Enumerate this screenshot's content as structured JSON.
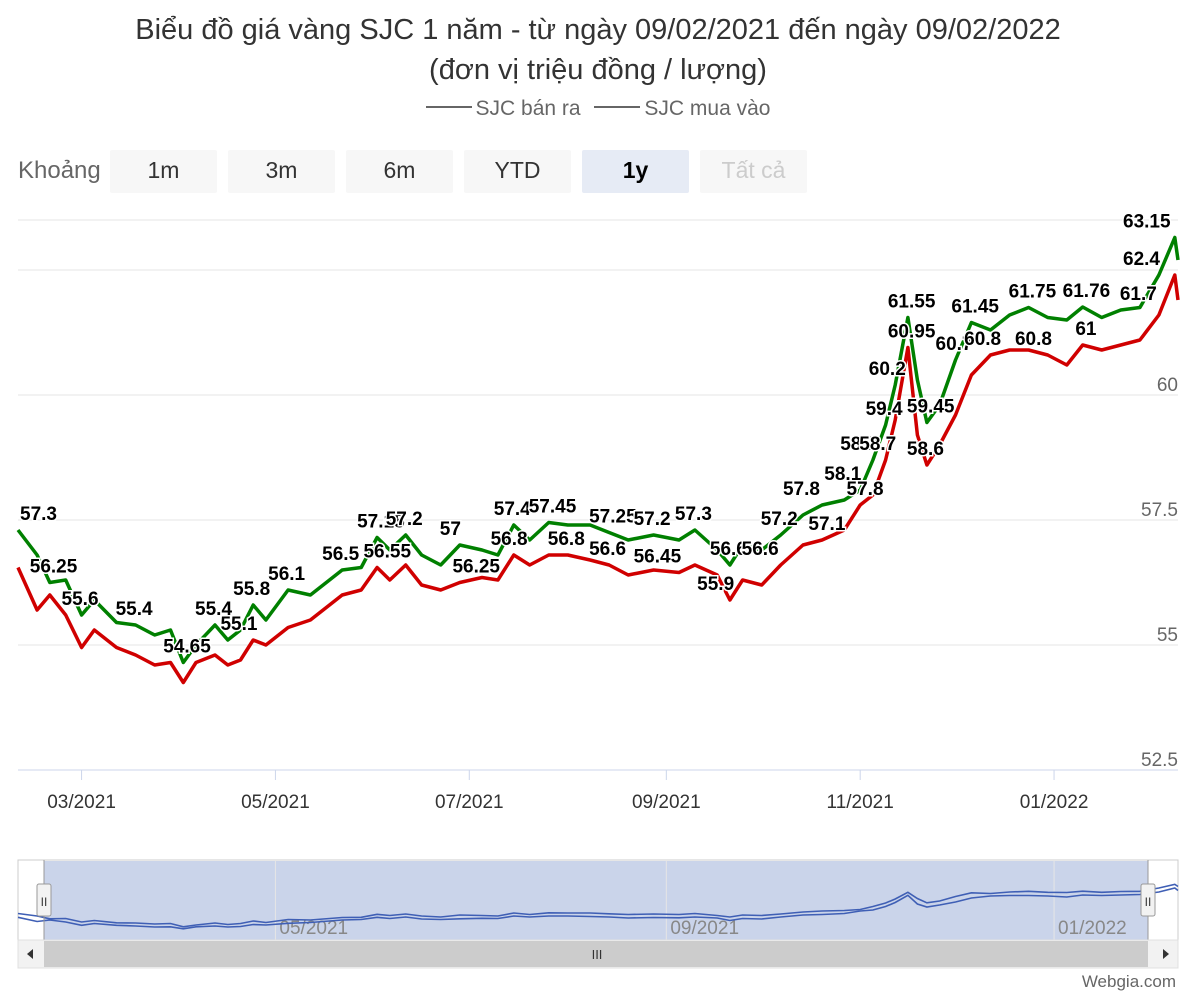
{
  "chart_data": {
    "type": "line",
    "title": "Biểu đồ giá vàng SJC 1 năm - từ ngày 09/02/2021 đến ngày 09/02/2022",
    "subtitle": "(đơn vị triệu đồng / lượng)",
    "ylim": [
      52.5,
      63.5
    ],
    "yticks": [
      "52.5",
      "55",
      "57.5",
      "60"
    ],
    "xticks": [
      "03/2021",
      "05/2021",
      "07/2021",
      "09/2021",
      "11/2021",
      "01/2022"
    ],
    "navigator_ticks": [
      "05/2021",
      "09/2021",
      "01/2022"
    ],
    "xrange": [
      "2021-02-09",
      "2022-02-09"
    ],
    "grid": true,
    "legend_position": "top-center",
    "series": [
      {
        "name": "SJC bán ra",
        "color": "#008000",
        "points": [
          [
            "2021-02-09",
            57.3
          ],
          [
            "2021-02-15",
            56.8
          ],
          [
            "2021-02-19",
            56.25
          ],
          [
            "2021-02-24",
            56.3
          ],
          [
            "2021-03-01",
            55.6
          ],
          [
            "2021-03-05",
            55.9
          ],
          [
            "2021-03-12",
            55.45
          ],
          [
            "2021-03-18",
            55.4
          ],
          [
            "2021-03-24",
            55.2
          ],
          [
            "2021-03-29",
            55.3
          ],
          [
            "2021-04-02",
            54.65
          ],
          [
            "2021-04-06",
            55.0
          ],
          [
            "2021-04-12",
            55.4
          ],
          [
            "2021-04-16",
            55.1
          ],
          [
            "2021-04-20",
            55.3
          ],
          [
            "2021-04-24",
            55.8
          ],
          [
            "2021-04-28",
            55.5
          ],
          [
            "2021-05-05",
            56.1
          ],
          [
            "2021-05-12",
            56.0
          ],
          [
            "2021-05-18",
            56.3
          ],
          [
            "2021-05-22",
            56.5
          ],
          [
            "2021-05-28",
            56.55
          ],
          [
            "2021-06-02",
            57.15
          ],
          [
            "2021-06-06",
            56.9
          ],
          [
            "2021-06-11",
            57.2
          ],
          [
            "2021-06-16",
            56.8
          ],
          [
            "2021-06-22",
            56.6
          ],
          [
            "2021-06-28",
            57.0
          ],
          [
            "2021-07-05",
            56.9
          ],
          [
            "2021-07-10",
            56.8
          ],
          [
            "2021-07-15",
            57.4
          ],
          [
            "2021-07-20",
            57.1
          ],
          [
            "2021-07-26",
            57.45
          ],
          [
            "2021-08-01",
            57.4
          ],
          [
            "2021-08-08",
            57.4
          ],
          [
            "2021-08-14",
            57.25
          ],
          [
            "2021-08-20",
            57.1
          ],
          [
            "2021-08-28",
            57.2
          ],
          [
            "2021-09-05",
            57.1
          ],
          [
            "2021-09-10",
            57.3
          ],
          [
            "2021-09-17",
            56.9
          ],
          [
            "2021-09-21",
            56.6
          ],
          [
            "2021-09-25",
            57.0
          ],
          [
            "2021-10-01",
            56.9
          ],
          [
            "2021-10-07",
            57.2
          ],
          [
            "2021-10-14",
            57.6
          ],
          [
            "2021-10-20",
            57.8
          ],
          [
            "2021-10-27",
            57.9
          ],
          [
            "2021-11-01",
            58.1
          ],
          [
            "2021-11-05",
            58.7
          ],
          [
            "2021-11-09",
            59.4
          ],
          [
            "2021-11-12",
            60.2
          ],
          [
            "2021-11-16",
            61.55
          ],
          [
            "2021-11-19",
            60.3
          ],
          [
            "2021-11-22",
            59.45
          ],
          [
            "2021-11-26",
            59.8
          ],
          [
            "2021-12-01",
            60.7
          ],
          [
            "2021-12-06",
            61.45
          ],
          [
            "2021-12-12",
            61.3
          ],
          [
            "2021-12-18",
            61.6
          ],
          [
            "2021-12-24",
            61.75
          ],
          [
            "2021-12-30",
            61.55
          ],
          [
            "2022-01-05",
            61.5
          ],
          [
            "2022-01-10",
            61.76
          ],
          [
            "2022-01-16",
            61.55
          ],
          [
            "2022-01-22",
            61.7
          ],
          [
            "2022-01-28",
            61.75
          ],
          [
            "2022-02-03",
            62.4
          ],
          [
            "2022-02-08",
            63.15
          ],
          [
            "2022-02-09",
            62.7
          ]
        ]
      },
      {
        "name": "SJC mua vào",
        "color": "#d00000",
        "points": [
          [
            "2021-02-09",
            56.55
          ],
          [
            "2021-02-15",
            55.7
          ],
          [
            "2021-02-19",
            56.0
          ],
          [
            "2021-02-24",
            55.6
          ],
          [
            "2021-03-01",
            54.95
          ],
          [
            "2021-03-05",
            55.3
          ],
          [
            "2021-03-12",
            54.95
          ],
          [
            "2021-03-18",
            54.8
          ],
          [
            "2021-03-24",
            54.6
          ],
          [
            "2021-03-29",
            54.65
          ],
          [
            "2021-04-02",
            54.25
          ],
          [
            "2021-04-06",
            54.65
          ],
          [
            "2021-04-12",
            54.8
          ],
          [
            "2021-04-16",
            54.6
          ],
          [
            "2021-04-20",
            54.7
          ],
          [
            "2021-04-24",
            55.1
          ],
          [
            "2021-04-28",
            55.0
          ],
          [
            "2021-05-05",
            55.35
          ],
          [
            "2021-05-12",
            55.5
          ],
          [
            "2021-05-18",
            55.8
          ],
          [
            "2021-05-22",
            56.0
          ],
          [
            "2021-05-28",
            56.1
          ],
          [
            "2021-06-02",
            56.55
          ],
          [
            "2021-06-06",
            56.3
          ],
          [
            "2021-06-11",
            56.6
          ],
          [
            "2021-06-16",
            56.2
          ],
          [
            "2021-06-22",
            56.1
          ],
          [
            "2021-06-28",
            56.25
          ],
          [
            "2021-07-05",
            56.35
          ],
          [
            "2021-07-10",
            56.3
          ],
          [
            "2021-07-15",
            56.8
          ],
          [
            "2021-07-20",
            56.6
          ],
          [
            "2021-07-26",
            56.8
          ],
          [
            "2021-08-01",
            56.8
          ],
          [
            "2021-08-08",
            56.7
          ],
          [
            "2021-08-14",
            56.6
          ],
          [
            "2021-08-20",
            56.4
          ],
          [
            "2021-08-28",
            56.5
          ],
          [
            "2021-09-05",
            56.45
          ],
          [
            "2021-09-10",
            56.6
          ],
          [
            "2021-09-17",
            56.4
          ],
          [
            "2021-09-21",
            55.9
          ],
          [
            "2021-09-25",
            56.3
          ],
          [
            "2021-10-01",
            56.2
          ],
          [
            "2021-10-07",
            56.6
          ],
          [
            "2021-10-14",
            57.0
          ],
          [
            "2021-10-20",
            57.1
          ],
          [
            "2021-10-27",
            57.3
          ],
          [
            "2021-11-01",
            57.8
          ],
          [
            "2021-11-05",
            58.0
          ],
          [
            "2021-11-09",
            58.7
          ],
          [
            "2021-11-12",
            59.5
          ],
          [
            "2021-11-16",
            60.95
          ],
          [
            "2021-11-19",
            59.2
          ],
          [
            "2021-11-22",
            58.6
          ],
          [
            "2021-11-26",
            59.0
          ],
          [
            "2021-12-01",
            59.6
          ],
          [
            "2021-12-06",
            60.4
          ],
          [
            "2021-12-12",
            60.8
          ],
          [
            "2021-12-18",
            60.9
          ],
          [
            "2021-12-24",
            60.9
          ],
          [
            "2021-12-30",
            60.8
          ],
          [
            "2022-01-05",
            60.6
          ],
          [
            "2022-01-10",
            61.0
          ],
          [
            "2022-01-16",
            60.9
          ],
          [
            "2022-01-22",
            61.0
          ],
          [
            "2022-01-28",
            61.1
          ],
          [
            "2022-02-03",
            61.6
          ],
          [
            "2022-02-08",
            62.4
          ],
          [
            "2022-02-09",
            61.9
          ]
        ]
      }
    ],
    "data_labels": [
      {
        "series": 0,
        "x": "2021-02-09",
        "text": "57.3"
      },
      {
        "series": 0,
        "x": "2021-02-19",
        "text": "56.25"
      },
      {
        "series": 0,
        "x": "2021-03-01",
        "text": "55.6"
      },
      {
        "series": 0,
        "x": "2021-03-18",
        "text": "55.4"
      },
      {
        "series": 0,
        "x": "2021-04-02",
        "text": "54.65"
      },
      {
        "series": 0,
        "x": "2021-04-12",
        "text": "55.4"
      },
      {
        "series": 0,
        "x": "2021-04-20",
        "text": "55.1"
      },
      {
        "series": 0,
        "x": "2021-04-24",
        "text": "55.8"
      },
      {
        "series": 0,
        "x": "2021-05-05",
        "text": "56.1"
      },
      {
        "series": 0,
        "x": "2021-05-22",
        "text": "56.5"
      },
      {
        "series": 0,
        "x": "2021-06-02",
        "text": "57.15"
      },
      {
        "series": 0,
        "x": "2021-06-04",
        "text": "56.55"
      },
      {
        "series": 0,
        "x": "2021-06-11",
        "text": "57.2"
      },
      {
        "series": 0,
        "x": "2021-06-28",
        "text": "57"
      },
      {
        "series": 0,
        "x": "2021-07-02",
        "text": "56.25"
      },
      {
        "series": 0,
        "x": "2021-07-15",
        "text": "57.4"
      },
      {
        "series": 0,
        "x": "2021-07-14",
        "text": "56.8"
      },
      {
        "series": 0,
        "x": "2021-07-26",
        "text": "57.45"
      },
      {
        "series": 0,
        "x": "2021-08-01",
        "text": "56.8"
      },
      {
        "series": 0,
        "x": "2021-08-14",
        "text": "57.25"
      },
      {
        "series": 0,
        "x": "2021-08-14",
        "text": "56.6"
      },
      {
        "series": 0,
        "x": "2021-08-28",
        "text": "57.2"
      },
      {
        "series": 0,
        "x": "2021-08-28",
        "text": "56.45"
      },
      {
        "series": 0,
        "x": "2021-09-10",
        "text": "57.3"
      },
      {
        "series": 0,
        "x": "2021-09-21",
        "text": "56.6"
      },
      {
        "series": 0,
        "x": "2021-09-17",
        "text": "55.9"
      },
      {
        "series": 0,
        "x": "2021-10-01",
        "text": "56.6"
      },
      {
        "series": 0,
        "x": "2021-10-07",
        "text": "57.2"
      },
      {
        "series": 0,
        "x": "2021-10-14",
        "text": "57.8"
      },
      {
        "series": 0,
        "x": "2021-10-22",
        "text": "57.1"
      },
      {
        "series": 0,
        "x": "2021-10-27",
        "text": "58.1"
      },
      {
        "series": 0,
        "x": "2021-11-01",
        "text": "58.7"
      },
      {
        "series": 0,
        "x": "2021-11-03",
        "text": "57.8"
      },
      {
        "series": 0,
        "x": "2021-11-09",
        "text": "59.4"
      },
      {
        "series": 0,
        "x": "2021-11-07",
        "text": "58.7"
      },
      {
        "series": 0,
        "x": "2021-11-10",
        "text": "60.2"
      },
      {
        "series": 0,
        "x": "2021-11-16",
        "text": "61.55"
      },
      {
        "series": 0,
        "x": "2021-11-16",
        "text": "60.95"
      },
      {
        "series": 0,
        "x": "2021-11-22",
        "text": "59.45"
      },
      {
        "series": 0,
        "x": "2021-11-22",
        "text": "58.6"
      },
      {
        "series": 0,
        "x": "2021-12-01",
        "text": "60.7"
      },
      {
        "series": 0,
        "x": "2021-12-06",
        "text": "61.45"
      },
      {
        "series": 0,
        "x": "2021-12-10",
        "text": "60.8"
      },
      {
        "series": 0,
        "x": "2021-12-24",
        "text": "61.75"
      },
      {
        "series": 0,
        "x": "2021-12-26",
        "text": "60.8"
      },
      {
        "series": 0,
        "x": "2022-01-10",
        "text": "61.76"
      },
      {
        "series": 0,
        "x": "2022-01-14",
        "text": "61"
      },
      {
        "series": 0,
        "x": "2022-01-28",
        "text": "61.7"
      },
      {
        "series": 0,
        "x": "2022-02-03",
        "text": "62.4"
      },
      {
        "series": 0,
        "x": "2022-02-08",
        "text": "63.15"
      }
    ]
  },
  "range_selector": {
    "label": "Khoảng",
    "buttons": [
      "1m",
      "3m",
      "6m",
      "YTD",
      "1y",
      "Tất cả"
    ],
    "selected": "1y",
    "disabled": "Tất cả"
  },
  "navigator": {
    "scrollbar_grip": "III",
    "handle_glyph": "II"
  },
  "credits": "Webgia.com"
}
